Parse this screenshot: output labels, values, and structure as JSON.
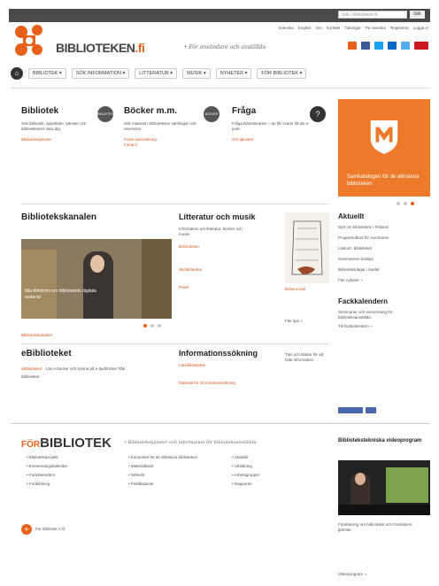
{
  "header": {
    "search_placeholder": "Sök i biblioteken.fi",
    "search_button": "Sök",
    "top_links": [
      "Svenska",
      "English",
      "Om",
      "Kontakt",
      "Tidningar",
      "Pa svenska",
      "Registrera",
      "Logga in"
    ],
    "brand_prefix": "BIBLIOTEKEN",
    "brand_suffix": ".fi",
    "tagline": "För användare och anställda"
  },
  "social": {
    "colors": [
      "#e8611a",
      "#3b5998",
      "#1da1f2",
      "#0a66c2",
      "#55acee",
      "#cc181e"
    ]
  },
  "nav": {
    "items": [
      "BIBLIOTEK",
      "SÖK INFORMATION",
      "LITTERATUR",
      "MUSIK",
      "NYHETER",
      "FÖR BIBLIOTEK"
    ]
  },
  "top_row": [
    {
      "title": "Bibliotek",
      "text": "Sök bibliotek, öppettider, tjänster och bibliotekskort nära dig.",
      "link": "Bibliotekstjänster",
      "badge": "BIBLIOTEK"
    },
    {
      "title": "Böcker m.m.",
      "text": "Sök material i bibliotekens samlingar och reservera.",
      "link": "Frank samsökning",
      "link2": "Finna.fi",
      "badge": "BÖCKER"
    },
    {
      "title": "Fråga",
      "text": "Fråga bibliotekarien – du får svaret till din e-post.",
      "link": "Om tjänsten",
      "badge": "?"
    }
  ],
  "promo": {
    "caption": "Samkatalogen för de allmänna biblioteken"
  },
  "aktuellt": {
    "title": "Aktuellt",
    "items": [
      "Nytt om biblioteken i Finland",
      "Programutbud för sommaren",
      "Läslust i biblioteket",
      "Sommarens boktips",
      "Biblioteksdagar i landet"
    ],
    "more": "Fler nyheter »"
  },
  "fackkalendern": {
    "title": "Fackkalendern",
    "text": "Seminarier och evenemang för biblioteksanställda.",
    "more": "Till fackkalendern »"
  },
  "bibkanal": {
    "title": "Bibliotekskanalen",
    "caption": "Mia Ahlström om bibliotekets digitala material",
    "link": "Bibliotekskanalen"
  },
  "littmusik": {
    "title": "Litteratur och musik",
    "intro": "Information om litteratur, böcker och musik.",
    "links": [
      "Bokmärken",
      "Skönlitteratur",
      "Poesi"
    ],
    "more": "Fler tips »",
    "book_title": "Bokens titel"
  },
  "ebib": {
    "title": "eBiblioteket",
    "link": "eBiblioteket",
    "text": "Läs e-böcker och lyssna på e-ljudböcker från biblioteket."
  },
  "infosok": {
    "title": "Informationssökning",
    "links": [
      "Länkbiblioteket",
      "Material för informationssökning"
    ],
    "side": "Tips och länkar för att hitta information."
  },
  "footer": {
    "brand_prefix": "FÖR",
    "brand_main": "BIBLIOTEK",
    "tagline": "Bibliotekstjänster och information för biblioteksanställda",
    "col1": [
      "Biblioteksprojekt",
      "Evenemangskalender",
      "Fackkalendern",
      "Fortbildning"
    ],
    "col2": [
      "Konsortiet för de allmänna biblioteken",
      "Materialbank",
      "Nätverk",
      "Publikationer"
    ],
    "col3": [
      "Statistik",
      "Utbildning",
      "Arbetsgrupper",
      "Rapporter"
    ],
    "more": "För bibliotek A-Ö"
  },
  "videoprog": {
    "title": "Bibliotekstekniska videoprogram",
    "text": "Föreläsning om biblioteket och framtidens tjänster.",
    "more": "Videoprogram »"
  }
}
